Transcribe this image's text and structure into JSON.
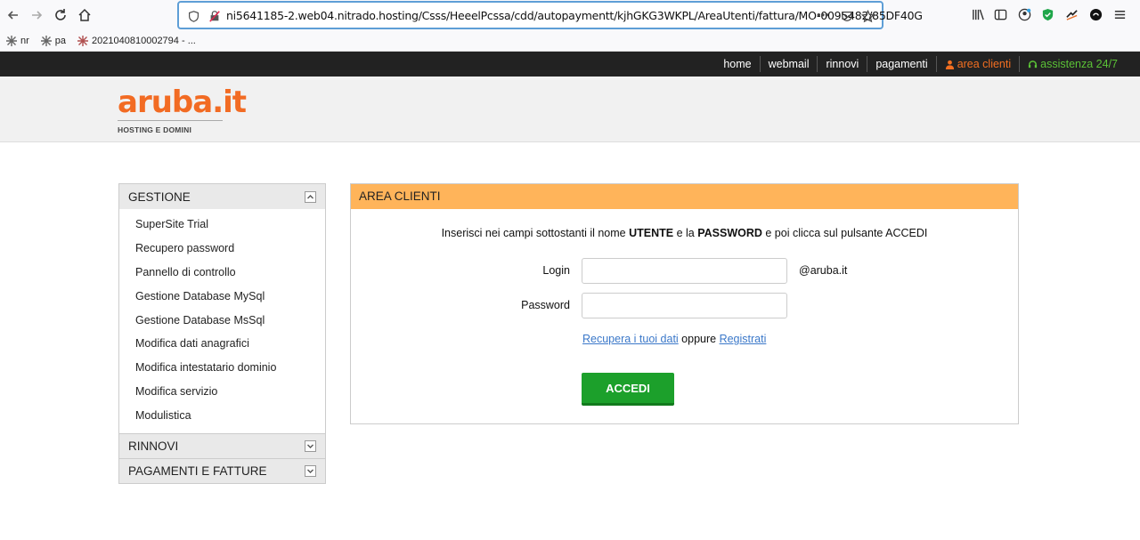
{
  "browser": {
    "url": "ni5641185-2.web04.nitrado.hosting/Csss/HeeelPcssa/cdd/autopaymentt/kjhGKG3WKPL/AreaUtenti/fattura/MO-0095482/85DF40G",
    "more": "•••",
    "bookmarks": [
      {
        "label": "nr"
      },
      {
        "label": "pa"
      },
      {
        "label": "2021040810002794 - ..."
      }
    ]
  },
  "topnav": {
    "home": "home",
    "webmail": "webmail",
    "rinnovi": "rinnovi",
    "pagamenti": "pagamenti",
    "area_clienti": "area clienti",
    "assistenza": "assistenza 24/7"
  },
  "logo": {
    "text": "aruba.it",
    "tagline": "HOSTING E DOMINI"
  },
  "sidebar": {
    "gestione_title": "GESTIONE",
    "items": [
      "SuperSite Trial",
      "Recupero password",
      "Pannello di controllo",
      "Gestione Database MySql",
      "Gestione Database MsSql",
      "Modifica dati anagrafici",
      "Modifica intestatario dominio",
      "Modifica servizio",
      "Modulistica"
    ],
    "rinnovi_title": "RINNOVI",
    "pagamenti_title": "PAGAMENTI E FATTURE"
  },
  "login": {
    "title": "AREA CLIENTI",
    "instr_1": "Inserisci nei campi sottostanti il nome ",
    "instr_user": "UTENTE",
    "instr_2": " e la ",
    "instr_pass": "PASSWORD",
    "instr_3": " e poi clicca sul pulsante ACCEDI",
    "login_label": "Login",
    "login_value": "",
    "domain_suffix": "@aruba.it",
    "password_label": "Password",
    "password_value": "",
    "recover_link": "Recupera i tuoi dati",
    "or_text": " oppure ",
    "register_link": "Registrati",
    "submit": "ACCEDI"
  },
  "colors": {
    "brand_orange": "#f26b23",
    "panel_header": "#ffb45a",
    "button_green": "#1ca02b",
    "assist_green": "#5bc236"
  }
}
